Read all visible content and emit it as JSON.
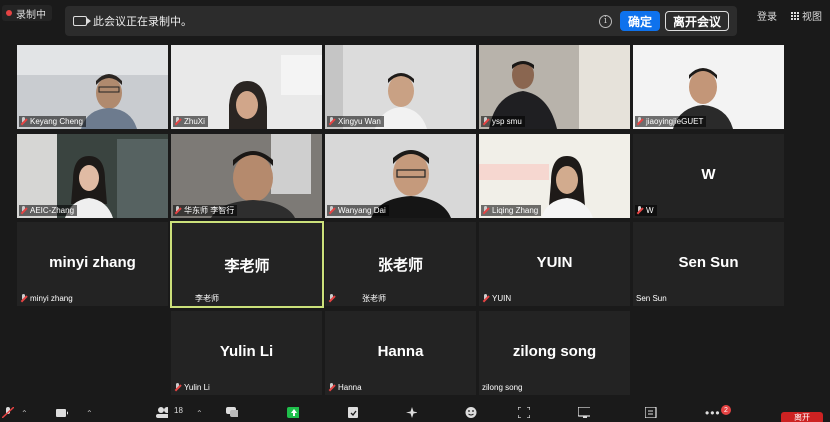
{
  "recording": {
    "label": "录制中"
  },
  "banner": {
    "message": "此会议正在录制中。",
    "info_glyph": "i",
    "ok_label": "确定",
    "leave_label": "离开会议"
  },
  "top_right": {
    "login_label": "登录",
    "view_label": "视图"
  },
  "tiles": [
    {
      "name": "Keyang Cheng",
      "muted": true
    },
    {
      "name": "ZhuXi",
      "muted": true
    },
    {
      "name": "Xingyu Wan",
      "muted": true
    },
    {
      "name": "ysp smu",
      "muted": true
    },
    {
      "name": "jiaoyingjieGUET",
      "muted": true
    },
    {
      "name": "AEIC-Zhang",
      "muted": true
    },
    {
      "name": "华东师 李智行",
      "muted": true
    },
    {
      "name": "Wanyang Dai",
      "muted": true
    },
    {
      "name": "Liqing Zhang",
      "muted": true
    },
    {
      "name": "W",
      "display": "W",
      "muted": true
    },
    {
      "name": "minyi zhang",
      "display": "minyi zhang",
      "muted": true
    },
    {
      "name": "李老师",
      "display": "李老师",
      "muted": false,
      "active": true
    },
    {
      "name": "张老师",
      "display": "张老师",
      "muted": true
    },
    {
      "name": "YUIN",
      "display": "YUIN",
      "muted": true
    },
    {
      "name": "Sen Sun",
      "display": "Sen Sun",
      "muted": false
    },
    {
      "name": "Yulin Li",
      "display": "Yulin Li",
      "muted": true
    },
    {
      "name": "Hanna",
      "display": "Hanna",
      "muted": true
    },
    {
      "name": "zilong song",
      "display": "zilong song",
      "muted": false
    }
  ],
  "toolbar": {
    "participant_count": "18",
    "chat_badge": "2",
    "end_label": "离开"
  },
  "colors": {
    "accent": "#0e72ed",
    "recording": "#e54343",
    "active_speaker": "#cbe07a"
  }
}
